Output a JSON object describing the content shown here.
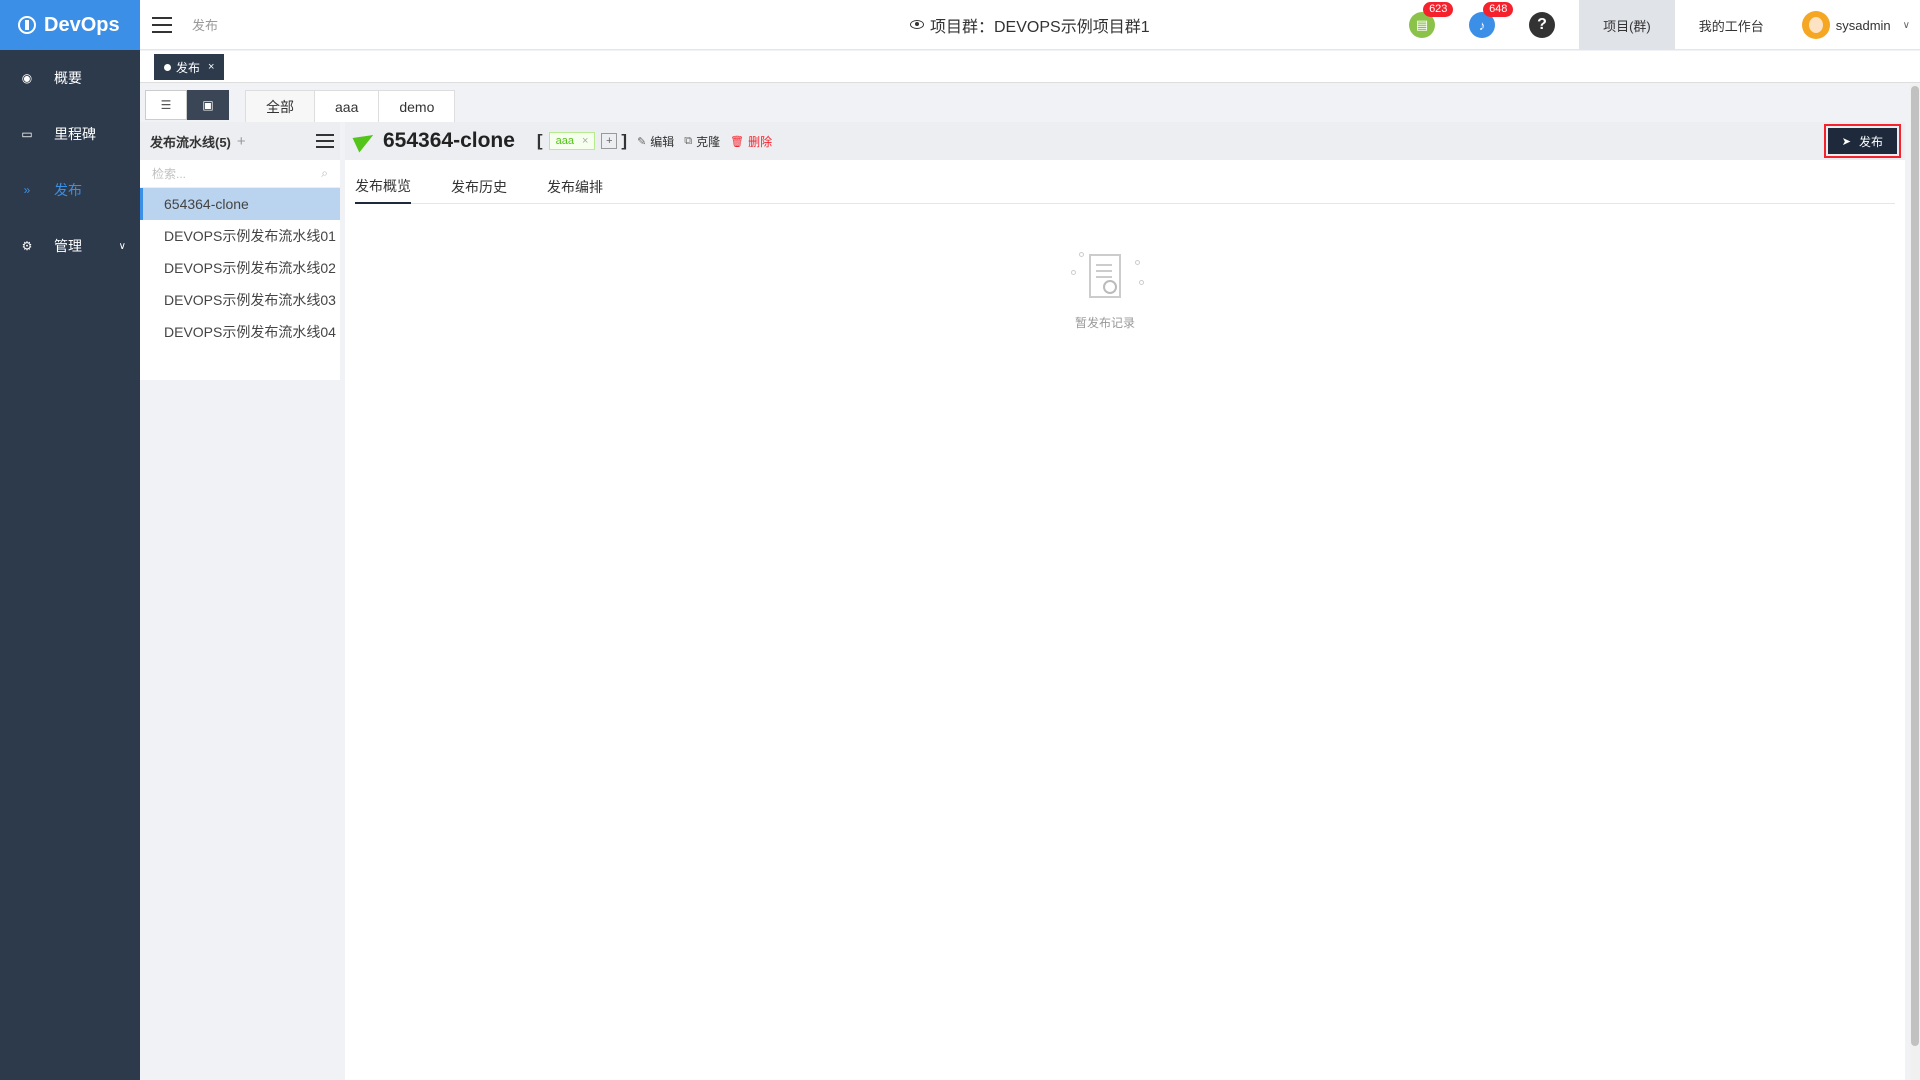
{
  "brand": {
    "name": "DevOps"
  },
  "sidebar": {
    "items": [
      {
        "label": "概要",
        "icon": "dashboard-icon"
      },
      {
        "label": "里程碑",
        "icon": "folder-icon"
      },
      {
        "label": "发布",
        "icon": "forward-icon",
        "active": true
      },
      {
        "label": "管理",
        "icon": "gear-icon",
        "expandable": true
      }
    ]
  },
  "header": {
    "breadcrumb": "发布",
    "project_title": "项目群：DEVOPS示例项目群1",
    "todo_badge": "623",
    "notify_badge": "648",
    "help_label": "?",
    "tabs": [
      {
        "label": "项目(群)"
      },
      {
        "label": "我的工作台"
      }
    ],
    "user": "sysadmin"
  },
  "page_tabs": [
    {
      "label": "发布",
      "close": "×"
    }
  ],
  "filter_tabs": [
    {
      "label": "全部"
    },
    {
      "label": "aaa"
    },
    {
      "label": "demo"
    }
  ],
  "pipeline_list": {
    "header": "发布流水线(5)",
    "add": "+",
    "search_placeholder": "检索...",
    "items": [
      "654364-clone",
      "DEVOPS示例发布流水线01",
      "DEVOPS示例发布流水线02",
      "DEVOPS示例发布流水线03",
      "DEVOPS示例发布流水线04"
    ]
  },
  "detail": {
    "title": "654364-clone",
    "tag": "aaa",
    "tag_close": "×",
    "tag_add": "+",
    "bracket_open": "[",
    "bracket_close": "]",
    "actions": {
      "edit": "编辑",
      "clone": "克隆",
      "delete": "删除"
    },
    "publish_button": "发布",
    "sub_tabs": [
      "发布概览",
      "发布历史",
      "发布编排"
    ],
    "empty_text": "暂发布记录"
  },
  "colors": {
    "sidebar_bg": "#2d3a4b",
    "brand_bg": "#3c8fe6",
    "accent": "#3c8fe6",
    "danger": "#f5222d",
    "success": "#52c41a",
    "todo_icon": "#8bc34a",
    "notify_icon": "#3c8fe6"
  }
}
